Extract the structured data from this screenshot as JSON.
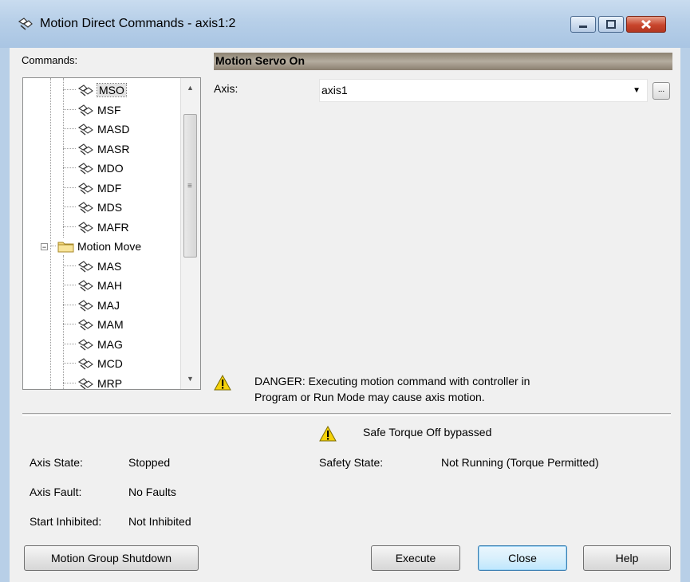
{
  "window": {
    "title": "Motion Direct Commands - axis1:2"
  },
  "commands": {
    "label": "Commands:",
    "tree": [
      {
        "label": "MSO",
        "type": "command",
        "selected": true
      },
      {
        "label": "MSF",
        "type": "command"
      },
      {
        "label": "MASD",
        "type": "command"
      },
      {
        "label": "MASR",
        "type": "command"
      },
      {
        "label": "MDO",
        "type": "command"
      },
      {
        "label": "MDF",
        "type": "command"
      },
      {
        "label": "MDS",
        "type": "command"
      },
      {
        "label": "MAFR",
        "type": "command"
      },
      {
        "label": "Motion Move",
        "type": "folder",
        "expanded": true
      },
      {
        "label": "MAS",
        "type": "command"
      },
      {
        "label": "MAH",
        "type": "command"
      },
      {
        "label": "MAJ",
        "type": "command"
      },
      {
        "label": "MAM",
        "type": "command"
      },
      {
        "label": "MAG",
        "type": "command"
      },
      {
        "label": "MCD",
        "type": "command"
      },
      {
        "label": "MRP",
        "type": "command"
      }
    ]
  },
  "command_panel": {
    "header": "Motion Servo On",
    "axis_label": "Axis:",
    "axis_value": "axis1",
    "browse_label": "...",
    "danger_line1": "DANGER: Executing motion command with controller in",
    "danger_line2": "Program or Run Mode may cause axis motion."
  },
  "status": {
    "safe_torque": "Safe Torque Off bypassed",
    "axis_state_label": "Axis State:",
    "axis_state_value": "Stopped",
    "axis_fault_label": "Axis Fault:",
    "axis_fault_value": "No Faults",
    "start_inhibited_label": "Start Inhibited:",
    "start_inhibited_value": "Not Inhibited",
    "safety_state_label": "Safety State:",
    "safety_state_value": "Not Running (Torque Permitted)"
  },
  "buttons": {
    "shutdown": "Motion Group Shutdown",
    "execute": "Execute",
    "close": "Close",
    "help": "Help"
  },
  "colors": {
    "titlebar": "#b7cfe8",
    "close_button": "#c8452c",
    "header_band": "#8d8272",
    "warning_icon": "#f5d20a"
  }
}
